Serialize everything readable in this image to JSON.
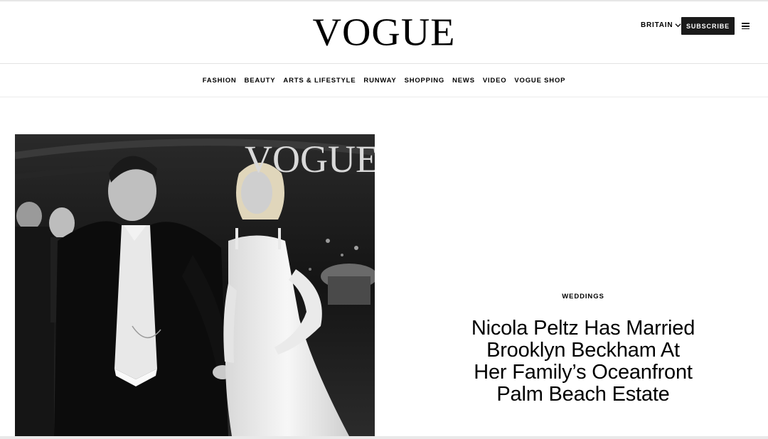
{
  "header": {
    "logo": "VOGUE",
    "region": "BRITAIN",
    "subscribe_label": "SUBSCRIBE"
  },
  "nav": {
    "items": [
      "FASHION",
      "BEAUTY",
      "ARTS & LIFESTYLE",
      "RUNWAY",
      "SHOPPING",
      "NEWS",
      "VIDEO",
      "VOGUE SHOP"
    ]
  },
  "article": {
    "image_watermark": "VOGUE",
    "category": "WEDDINGS",
    "headline": "Nicola Peltz Has Married Brooklyn Beckham At Her Family’s Oceanfront Palm Beach Estate"
  },
  "icons": {
    "region_chevron": "chevron-down-icon",
    "menu": "hamburger-menu-icon"
  }
}
